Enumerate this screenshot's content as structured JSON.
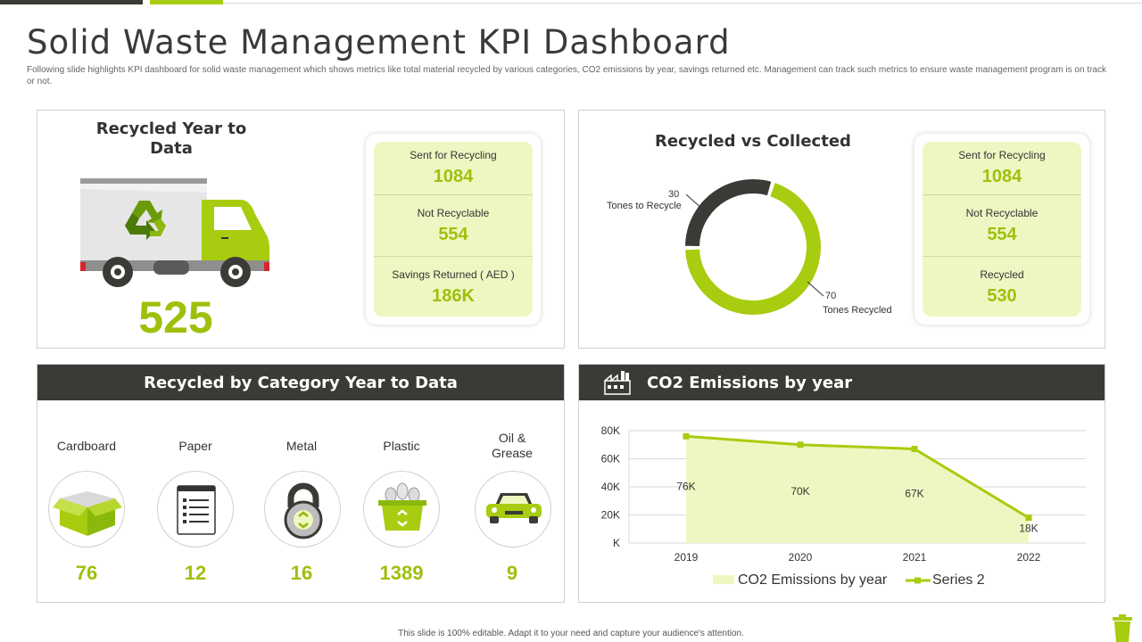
{
  "page": {
    "title": "Solid Waste Management KPI Dashboard",
    "subtitle": "Following slide highlights KPI  dashboard for solid waste management which shows metrics like total material recycled by various categories, CO2 emissions by year, savings returned etc. Management can track such metrics to ensure waste management program is on track or not.",
    "footer": "This slide is 100% editable.  Adapt it to your need and capture your audience's attention."
  },
  "recycled_ytd": {
    "heading_line1": "Recycled Year to",
    "heading_line2": "Data",
    "total": "525",
    "stats": [
      {
        "label": "Sent for Recycling",
        "value": "1084"
      },
      {
        "label": "Not Recyclable",
        "value": "554"
      },
      {
        "label": "Savings Returned ( AED )",
        "value": "186K"
      }
    ]
  },
  "recycled_vs_collected": {
    "heading": "Recycled vs Collected",
    "donut": {
      "slices": [
        {
          "value": 30,
          "value_label": "30",
          "label": "Tones to Recycle",
          "color": "#3c3a36"
        },
        {
          "value": 70,
          "value_label": "70",
          "label": "Tones Recycled",
          "color": "#a8cc0f"
        }
      ]
    },
    "stats": [
      {
        "label": "Sent for Recycling",
        "value": "1084"
      },
      {
        "label": "Not Recyclable",
        "value": "554"
      },
      {
        "label": "Recycled",
        "value": "530"
      }
    ]
  },
  "by_category": {
    "heading": "Recycled by Category Year to Data",
    "items": [
      {
        "name": "Cardboard",
        "value": "76",
        "icon": "cardboard-box-icon"
      },
      {
        "name": "Paper",
        "value": "12",
        "icon": "paper-notepad-icon"
      },
      {
        "name": "Metal",
        "value": "16",
        "icon": "metal-lock-icon"
      },
      {
        "name": "Plastic",
        "value": "1389",
        "icon": "plastic-bin-icon"
      },
      {
        "name": "Oil &\nGrease",
        "value": "9",
        "icon": "car-icon"
      }
    ]
  },
  "co2": {
    "heading": "CO2 Emissions by year",
    "icon": "factory-icon"
  },
  "chart_data": {
    "type": "area",
    "title": "CO2 Emissions by year",
    "categories": [
      "2019",
      "2020",
      "2021",
      "2022"
    ],
    "series": [
      {
        "name": "CO2 Emissions by year",
        "values": [
          76000,
          70000,
          67000,
          18000
        ],
        "color": "#eef7c2"
      },
      {
        "name": "Series 2",
        "values": [
          76000,
          70000,
          67000,
          18000
        ],
        "color": "#a8cc0f"
      }
    ],
    "data_labels": [
      "76K",
      "70K",
      "67K",
      "18K"
    ],
    "y_ticks": [
      "K",
      "20K",
      "40K",
      "60K",
      "80K"
    ],
    "ylim": [
      0,
      80000
    ],
    "grid": true,
    "legend": "bottom"
  },
  "colors": {
    "accent": "#a8cc0f",
    "dark": "#3c3a36",
    "light_green": "#eef7c2"
  }
}
